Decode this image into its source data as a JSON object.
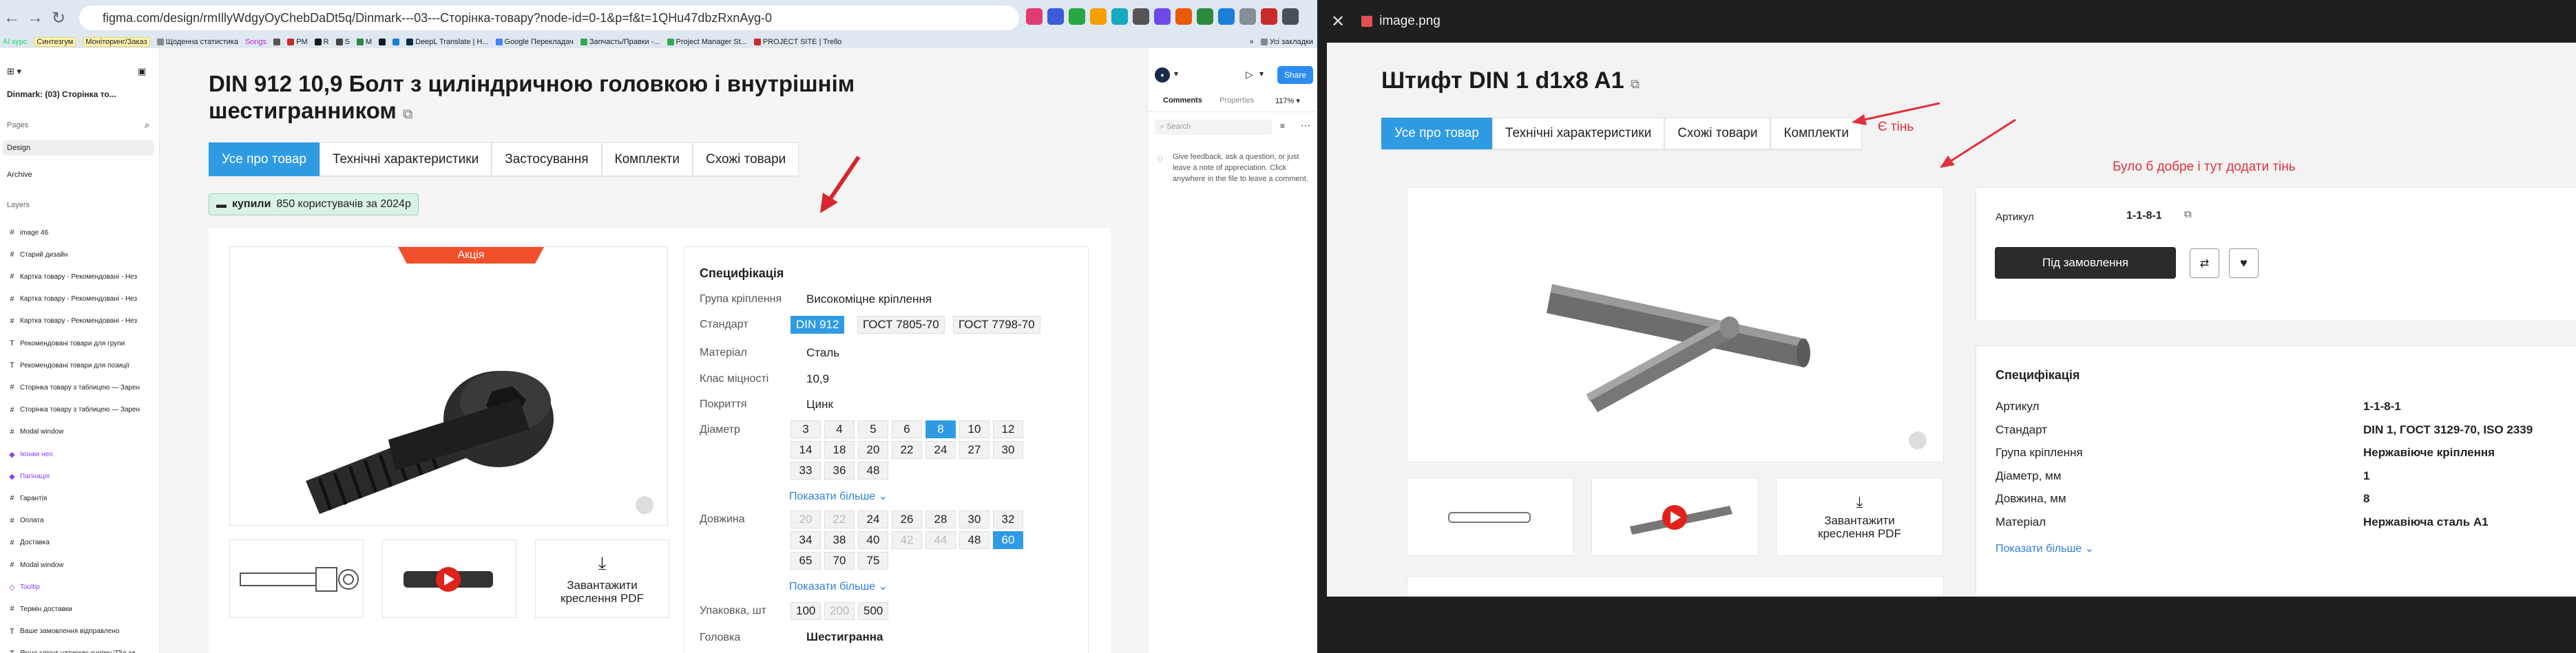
{
  "browser": {
    "url": "figma.com/design/rmIllyWdgyOyChebDaDt5q/Dinmark---03---Сторінка-товару?node-id=0-1&p=f&t=1QHu47dbzRxnAyg-0",
    "bookmarks": [
      "AI курс",
      "Синтезгум",
      "Моніторинг/Заказ",
      "Щоденна статистика",
      "Songs",
      "PM",
      "R",
      "S",
      "M",
      "DeepL Translate | H...",
      "Google Перекладач",
      "Запчасть/Правки -...",
      "Project Manager St...",
      "PROJECT SITE | Trello"
    ],
    "bookmarks_more": "»",
    "all_bookmarks": "Усі закладки"
  },
  "figma_left": {
    "file_name": "Dinmark: (03) Сторінка то...",
    "pages_label": "Pages",
    "pages": [
      "Design",
      "Archive"
    ],
    "layers_label": "Layers",
    "layers": [
      {
        "icon": "#",
        "name": "image 46",
        "color": "#222"
      },
      {
        "icon": "#",
        "name": "Старий дизайн",
        "color": "#222"
      },
      {
        "icon": "#",
        "name": "Картка товару - Рекомендовані - Нез",
        "color": "#222"
      },
      {
        "icon": "#",
        "name": "Картка товару - Рекомендовані - Нез",
        "color": "#222"
      },
      {
        "icon": "#",
        "name": "Картка товару - Рекомендовані - Нез",
        "color": "#222"
      },
      {
        "icon": "T",
        "name": "Рекомендовані товари для групи",
        "color": "#222"
      },
      {
        "icon": "T",
        "name": "Рекомендовані товари для позиції",
        "color": "#222"
      },
      {
        "icon": "#",
        "name": "Сторінка товару з таблицею — Зарен",
        "color": "#222"
      },
      {
        "icon": "#",
        "name": "Сторінка товару з таблицею — Зарен",
        "color": "#222"
      },
      {
        "icon": "#",
        "name": "Modal window",
        "color": "#222"
      },
      {
        "icon": "◆",
        "name": "Іконки нео",
        "color": "#8a3ff0"
      },
      {
        "icon": "◆",
        "name": "Пагінація",
        "color": "#8a3ff0"
      },
      {
        "icon": "#",
        "name": "Гарантія",
        "color": "#222"
      },
      {
        "icon": "#",
        "name": "Оплата",
        "color": "#222"
      },
      {
        "icon": "#",
        "name": "Доставка",
        "color": "#222"
      },
      {
        "icon": "#",
        "name": "Modal window",
        "color": "#222"
      },
      {
        "icon": "◇",
        "name": "Tooltip",
        "color": "#8a3ff0"
      },
      {
        "icon": "#",
        "name": "Термін доставки",
        "color": "#222"
      },
      {
        "icon": "T",
        "name": "Ваше замовлення відправлено",
        "color": "#222"
      },
      {
        "icon": "T",
        "name": "Якщо клієнт натискає кнопку \"Під за",
        "color": "#222"
      }
    ]
  },
  "figma_right": {
    "share": "Share",
    "tabs": [
      "Comments",
      "Properties"
    ],
    "zoom": "117%",
    "search_placeholder": "Search",
    "feedback": "Give feedback, ask a question, or just leave a note of appreciation. Click anywhere in the file to leave a comment."
  },
  "design": {
    "title": "DIN 912 10,9 Болт з циліндричною головкою і внутрішнім шестигранником",
    "tabs": [
      "Усе про товар",
      "Технічні характеристики",
      "Застосування",
      "Комплекти",
      "Схожі товари"
    ],
    "badge_bold": "купили",
    "badge_rest": "850 користувачів за 2024р",
    "promo": "Акція",
    "download": "Завантажити креслення PDF",
    "spec_title": "Специфікація",
    "rows": {
      "group": {
        "label": "Група кріплення",
        "value": "Високоміцне кріплення"
      },
      "standard": {
        "label": "Стандарт",
        "options": [
          "DIN 912",
          "ГОСТ 7805-70",
          "ГОСТ 7798-70"
        ]
      },
      "material": {
        "label": "Матеріал",
        "value": "Сталь"
      },
      "strength": {
        "label": "Клас міцності",
        "value": "10,9"
      },
      "coating": {
        "label": "Покриття",
        "value": "Цинк"
      },
      "diameter": {
        "label": "Діаметр",
        "options": [
          "3",
          "4",
          "5",
          "6",
          "8",
          "10",
          "12",
          "14",
          "18",
          "20",
          "22",
          "24",
          "27",
          "30",
          "33",
          "36",
          "48"
        ]
      },
      "more1": "Показати більше",
      "length": {
        "label": "Довжина",
        "options": [
          "20",
          "22",
          "24",
          "26",
          "28",
          "30",
          "32",
          "34",
          "38",
          "40",
          "42",
          "44",
          "48",
          "60",
          "65",
          "70",
          "75"
        ]
      },
      "more2": "Показати більше",
      "package": {
        "label": "Упаковка, шт",
        "options": [
          "100",
          "200",
          "500"
        ]
      },
      "head": {
        "label": "Головка",
        "value": "Шестигранна"
      }
    }
  },
  "viewer": {
    "file": "image.png",
    "title": "Штифт DIN 1 d1x8 A1",
    "tabs": [
      "Усе про товар",
      "Технічні характеристики",
      "Схожі товари",
      "Комплекти"
    ],
    "note1": "Є тінь",
    "note2": "Було б добре і тут додати тінь",
    "article_label": "Артикул",
    "article_value": "1-1-8-1",
    "order_button": "Під замовлення",
    "download": "Завантажити креслення PDF",
    "spec_title": "Специфікація",
    "spec": [
      {
        "label": "Артикул",
        "value": "1-1-8-1"
      },
      {
        "label": "Стандарт",
        "value": "DIN 1, ГОСТ 3129-70, ISO 2339"
      },
      {
        "label": "Група кріплення",
        "value": "Нержавіюче кріплення"
      },
      {
        "label": "Діаметр, мм",
        "value": "1"
      },
      {
        "label": "Довжина, мм",
        "value": "8"
      },
      {
        "label": "Матеріал",
        "value": "Нержавіюча сталь А1"
      }
    ],
    "more": "Показати більше"
  }
}
